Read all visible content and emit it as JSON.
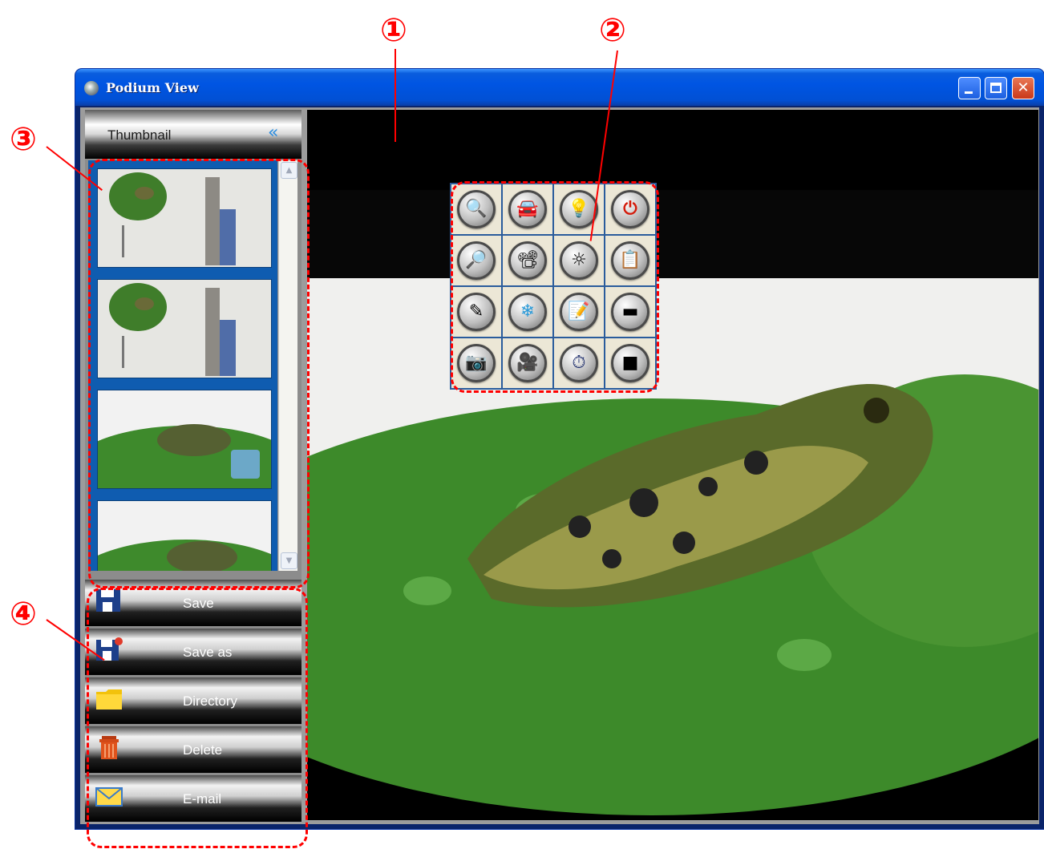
{
  "callouts": [
    "①",
    "②",
    "③",
    "④"
  ],
  "window": {
    "title": "Podium View"
  },
  "sidebar": {
    "header": {
      "title": "Thumbnail",
      "collapse_glyph": "«"
    },
    "thumbnails": [
      {
        "subject": "lumens-booklet-and-frog",
        "selected": false
      },
      {
        "subject": "lumens-booklet-and-frog",
        "selected": false
      },
      {
        "subject": "frog-on-lily-pad-video",
        "selected": false
      },
      {
        "subject": "frog-on-lily-pad",
        "selected": false
      }
    ],
    "actions": [
      {
        "label": "Save",
        "icon": "floppy-disk-icon"
      },
      {
        "label": "Save as",
        "icon": "floppy-disk-star-icon"
      },
      {
        "label": "Directory",
        "icon": "folder-icon"
      },
      {
        "label": "Delete",
        "icon": "trash-can-icon"
      },
      {
        "label": "E-mail",
        "icon": "envelope-icon"
      }
    ]
  },
  "toolbar": {
    "buttons": [
      {
        "icon": "search-document-icon",
        "glyph": "🔍"
      },
      {
        "icon": "car-icon",
        "glyph": "🚘"
      },
      {
        "icon": "lamp-icon",
        "glyph": "💡"
      },
      {
        "icon": "power-icon",
        "glyph": "⏻"
      },
      {
        "icon": "zoom-in-icon",
        "glyph": "🔎"
      },
      {
        "icon": "document-camera-icon",
        "glyph": "📽"
      },
      {
        "icon": "brightness-icon",
        "glyph": "☼"
      },
      {
        "icon": "clipboard-icon",
        "glyph": "📋"
      },
      {
        "icon": "annotate-pen-icon",
        "glyph": "✎"
      },
      {
        "icon": "freeze-icon",
        "glyph": "❄"
      },
      {
        "icon": "notes-icon",
        "glyph": "📝"
      },
      {
        "icon": "mask-icon",
        "glyph": "▬"
      },
      {
        "icon": "camera-capture-icon",
        "glyph": "📷"
      },
      {
        "icon": "video-record-icon",
        "glyph": "🎥"
      },
      {
        "icon": "timer-icon",
        "glyph": "⏱"
      },
      {
        "icon": "stop-icon",
        "glyph": "■"
      }
    ]
  },
  "colors": {
    "annotation": "#ff0000",
    "title_bar": "#0055e3",
    "thumbnail_frame": "#0f5cb0",
    "viewer_background": "#000000"
  }
}
